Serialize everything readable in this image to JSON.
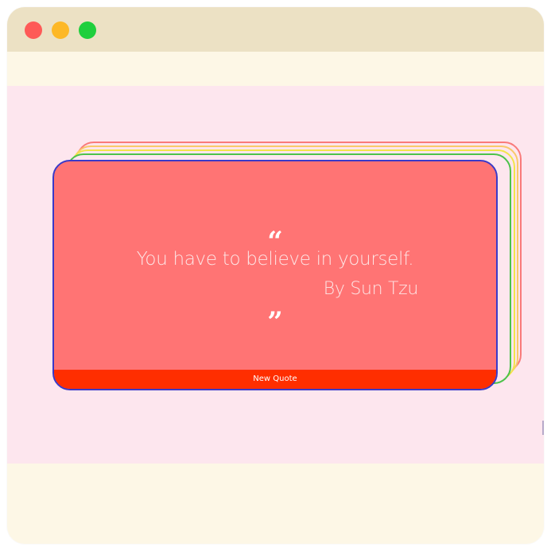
{
  "window": {
    "controls": [
      "close",
      "minimize",
      "maximize"
    ]
  },
  "quote_card": {
    "open_quote": "“",
    "text": "You have to believe in yourself.",
    "author": "By Sun Tzu",
    "close_quote": "”",
    "button_label": "New Quote"
  },
  "colors": {
    "card_fill": "#ff7474",
    "button_fill": "#ff2e00",
    "page_background": "#fde6ee",
    "titlebar": "#ece1c4",
    "stack_outlines": [
      "#f97a7a",
      "#f8c96a",
      "#f2e54a",
      "#4cc24a",
      "#3a3ac8"
    ]
  }
}
